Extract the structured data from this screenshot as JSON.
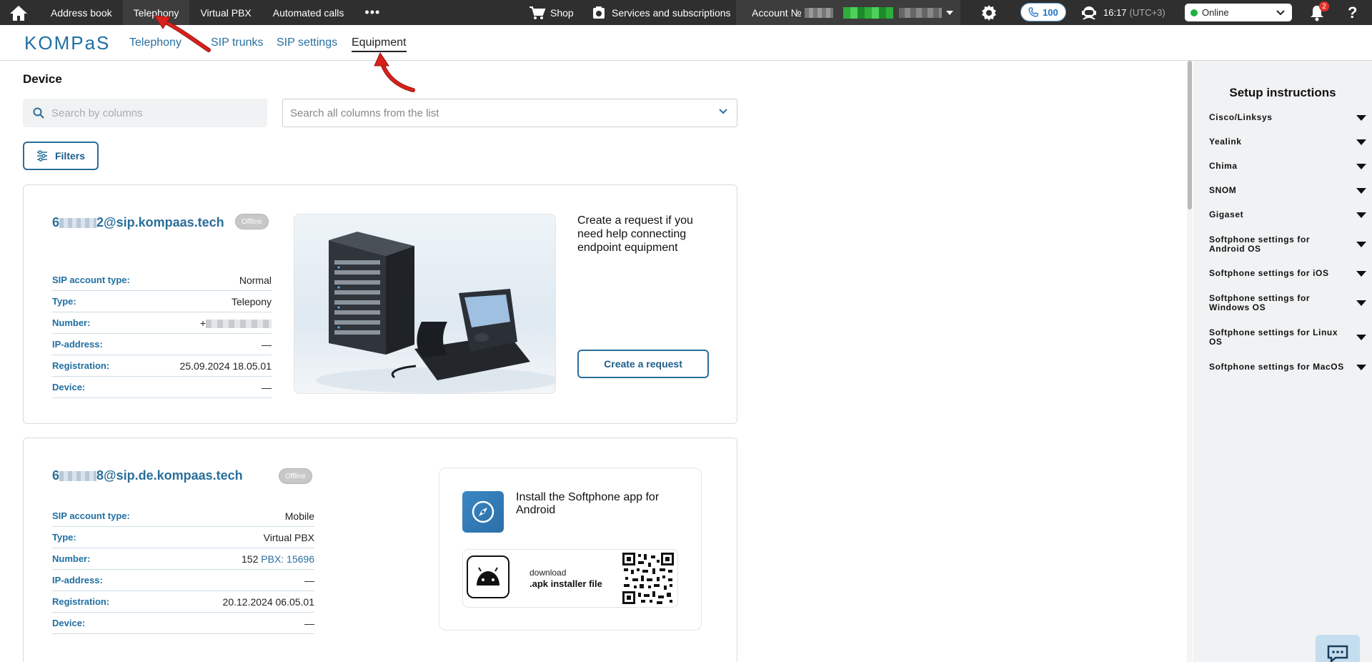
{
  "topbar": {
    "home_icon": "home-icon",
    "nav": [
      {
        "label": "Address book"
      },
      {
        "label": "Telephony",
        "active": true
      },
      {
        "label": "Virtual PBX"
      },
      {
        "label": "Automated calls"
      }
    ],
    "more_label": "•••",
    "shop_label": "Shop",
    "services_label": "Services and subscriptions",
    "account_label": "Account №",
    "calls_count": "100",
    "time": "16:17",
    "timezone": "(UTC+3)",
    "status": "Online",
    "notifications_count": "2",
    "help_label": "?"
  },
  "subnav": {
    "logo": "KOMPaS",
    "tabs": [
      {
        "label": "Telephony"
      },
      {
        "label": "SIP trunks"
      },
      {
        "label": "SIP settings"
      },
      {
        "label": "Equipment",
        "active": true
      }
    ]
  },
  "main": {
    "title": "Device",
    "search_placeholder": "Search by columns",
    "columns_placeholder": "Search all columns from the list",
    "filters_label": "Filters"
  },
  "devices": [
    {
      "sip_prefix": "6",
      "sip_suffix": "2@sip.kompaas.tech",
      "status": "Offline",
      "fields": [
        {
          "label": "SIP account type:",
          "value": "Normal"
        },
        {
          "label": "Type:",
          "value": "Telepony"
        },
        {
          "label": "Number:",
          "value": "+"
        },
        {
          "label": "IP-address:",
          "value": "—"
        },
        {
          "label": "Registration:",
          "value": "25.09.2024 18.05.01"
        },
        {
          "label": "Device:",
          "value": "—"
        }
      ],
      "promo_text": "Create a request if you need help connecting endpoint equipment",
      "request_button": "Create a request"
    },
    {
      "sip_prefix": "6",
      "sip_suffix": "8@sip.de.kompaas.tech",
      "status": "Offline",
      "fields": [
        {
          "label": "SIP account type:",
          "value": "Mobile"
        },
        {
          "label": "Type:",
          "value": "Virtual PBX"
        },
        {
          "label": "Number:",
          "value": "152",
          "link": "PBX: 15696"
        },
        {
          "label": "IP-address:",
          "value": "—"
        },
        {
          "label": "Registration:",
          "value": "20.12.2024 06.05.01"
        },
        {
          "label": "Device:",
          "value": "—"
        }
      ],
      "install_text": "Install the Softphone app for Android",
      "download_small": "download",
      "download_big": ".apk installer file"
    }
  ],
  "setup": {
    "title": "Setup instructions",
    "items": [
      {
        "label": "Cisco/Linksys"
      },
      {
        "label": "Yealink"
      },
      {
        "label": "Chima"
      },
      {
        "label": "SNOM"
      },
      {
        "label": "Gigaset"
      },
      {
        "label": "Softphone settings for Android OS"
      },
      {
        "label": "Softphone settings for iOS"
      },
      {
        "label": "Softphone settings for Windows OS"
      },
      {
        "label": "Softphone settings for Linux OS"
      },
      {
        "label": "Softphone settings for MacOS"
      }
    ]
  },
  "colors": {
    "topbar_bg": "#2f2f2f",
    "accent_blue": "#2a6e9a",
    "online_green": "#1fb141",
    "notification_red": "#e3322b",
    "annotation_arrow": "#d8201a"
  }
}
